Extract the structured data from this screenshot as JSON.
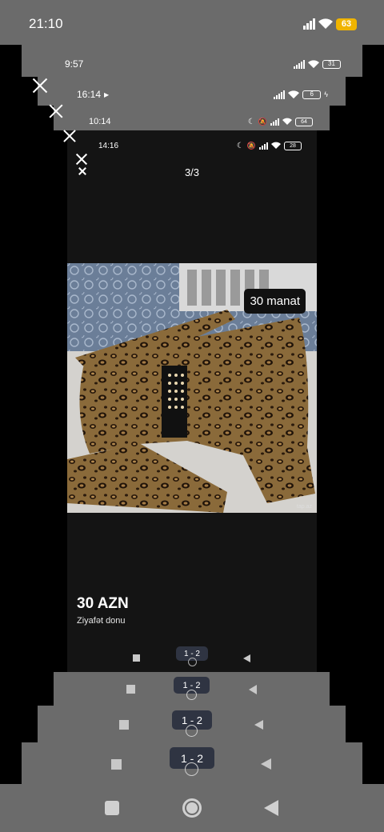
{
  "screens": [
    {
      "time": "21:10",
      "battery": "63"
    },
    {
      "time": "9:57",
      "battery": "31"
    },
    {
      "time": "16:14",
      "battery": "6"
    },
    {
      "time": "10:14",
      "battery": "64"
    },
    {
      "time": "14:16",
      "battery": "28"
    }
  ],
  "viewer": {
    "page_indicator": "3/3"
  },
  "photo_badge": "30 manat",
  "photo_watermark": "tap.az",
  "listing": {
    "price": "30 AZN",
    "title": "Ziyafət donu"
  },
  "page_pill": "1 - 2",
  "colors": {
    "gray_layer": "#6b6b6b",
    "battery_accent": "#f0b400",
    "pill": "#2f3442"
  }
}
